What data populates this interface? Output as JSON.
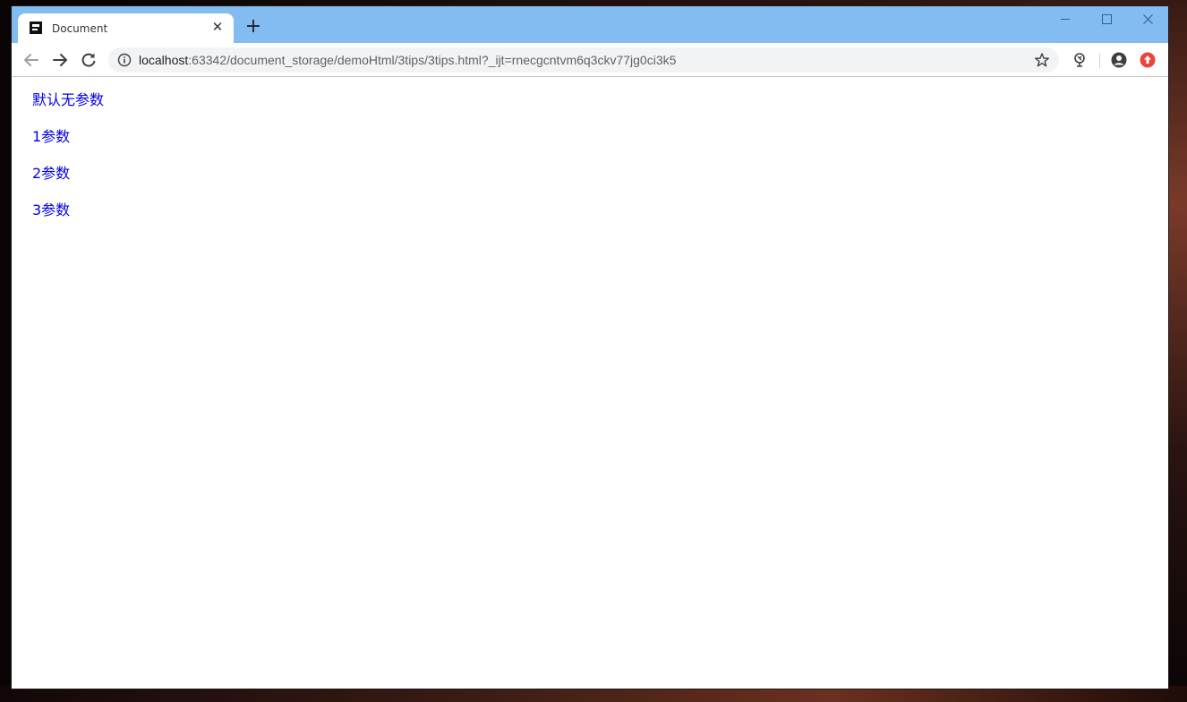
{
  "browser": {
    "tab": {
      "title": "Document",
      "close_glyph": "✕"
    },
    "new_tab_glyph": "+",
    "address_bar": {
      "host": "localhost",
      "rest": ":63342/document_storage/demoHtml/3tips/3tips.html?_ijt=rnecgcntvm6q3ckv77jg0ci3k5"
    },
    "icons": {
      "back": "back-arrow-icon",
      "forward": "forward-arrow-icon",
      "reload": "reload-icon",
      "info": "info-icon",
      "star": "bookmark-star-icon",
      "extension": "extension-icon",
      "profile": "profile-icon",
      "update": "update-icon"
    },
    "colors": {
      "titlebar": "#82bcf0",
      "update_badge": "#e8453c",
      "link": "#0000ee"
    }
  },
  "page": {
    "links": [
      {
        "label": "默认无参数"
      },
      {
        "label": "1参数"
      },
      {
        "label": "2参数"
      },
      {
        "label": "3参数"
      }
    ]
  }
}
